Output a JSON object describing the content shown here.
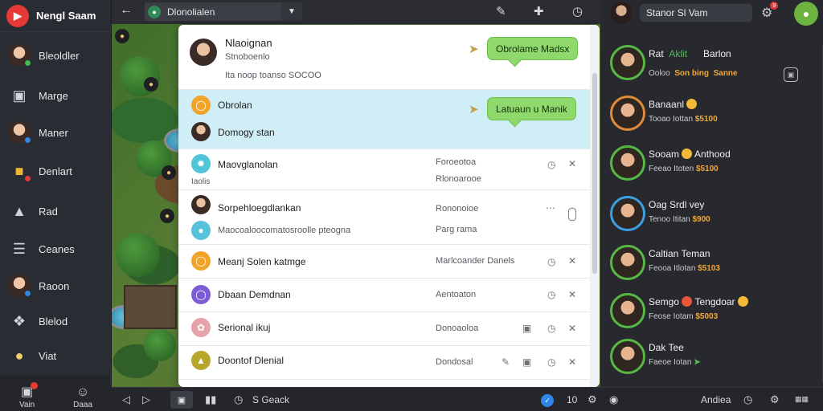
{
  "app": {
    "title": "Nengl Saam",
    "logo_glyph": "▶"
  },
  "sidebar": {
    "items": [
      {
        "label": "Bleoldler",
        "icon": "avatar",
        "status_color": "#3fb950"
      },
      {
        "label": "Marge",
        "icon": "bag-icon"
      },
      {
        "label": "Maner",
        "icon": "avatar",
        "status_color": "#2f86e5"
      },
      {
        "label": "Denlart",
        "icon": "badge-icon"
      },
      {
        "label": "Rad",
        "icon": "inbox-icon"
      },
      {
        "label": "Ceanes",
        "icon": "list-icon"
      },
      {
        "label": "Raoon",
        "icon": "avatar",
        "status_color": "#2f86e5"
      },
      {
        "label": "Blelod",
        "icon": "puzzle-icon"
      },
      {
        "label": "Viat",
        "icon": "chat-bubble-icon"
      }
    ],
    "bottom": [
      {
        "label": "Vain",
        "icon": "home-icon"
      },
      {
        "label": "Daaa",
        "icon": "smile-icon"
      }
    ]
  },
  "topbar": {
    "channel": "Dlonolialen"
  },
  "panel": {
    "header": {
      "name": "Nlaoignan",
      "sub": "Stnoboenlo",
      "detail": "Ita noop toanso SOCOO",
      "bubble": "Obrolame Madsx"
    },
    "highlight": {
      "name": "Obrolan",
      "sub": "Domogy stan",
      "bubble": "Latuaun u Manik"
    },
    "rows": [
      {
        "name": "Maovglanolan",
        "sub": "Iaolis",
        "meta1": "Foroeotoa",
        "meta2": "Rlonoarooe",
        "icon": "teal"
      },
      {
        "name": "Sorpehloegdlankan",
        "sub": "Maocoaloocomatosroolle pteogna",
        "meta1": "Rononoioe",
        "meta2": "Parg rama",
        "icon": "person"
      },
      {
        "name": "Meanj Solen katmge",
        "meta1": "Marlcoander Danels",
        "icon": "orange"
      },
      {
        "name": "Dbaan Demdnan",
        "meta1": "Aentoaton",
        "icon": "purple"
      },
      {
        "name": "Serional ikuj",
        "meta1": "Donoaoloa",
        "icon": "pink"
      },
      {
        "name": "Doontof Dlenial",
        "meta1": "Dondosal",
        "icon": "olive"
      }
    ]
  },
  "right": {
    "user": "Stanor Sl Vam",
    "notif_count": "9",
    "friends": [
      {
        "name": "Rat",
        "name2": "Aklit",
        "name3": "Barlon",
        "sub": "Ooloo",
        "sub_gold": "Son bing",
        "sub_gold2": "Sanne"
      },
      {
        "name": "Banaanl",
        "sub": "Tooao Iottan",
        "sub_gold": "$5100"
      },
      {
        "name": "Sooam",
        "name2": "Anthood",
        "sub": "Feeao Itoten",
        "sub_gold": "$5100"
      },
      {
        "name": "Oag Srdl vey",
        "sub": "Tenoo Ititan",
        "sub_gold": "$900"
      },
      {
        "name": "Caltian Teman",
        "sub": "Feooa Itlotan",
        "sub_gold": "$5103"
      },
      {
        "name": "Semgo",
        "name2": "Tengdoar",
        "sub": "Feose Iotam",
        "sub_gold": "$5003"
      },
      {
        "name": "Dak Tee",
        "sub": "Faeoe Iotan"
      }
    ]
  },
  "bottombar": {
    "status": "S Geack",
    "count": "10",
    "right_label": "Andiea"
  }
}
